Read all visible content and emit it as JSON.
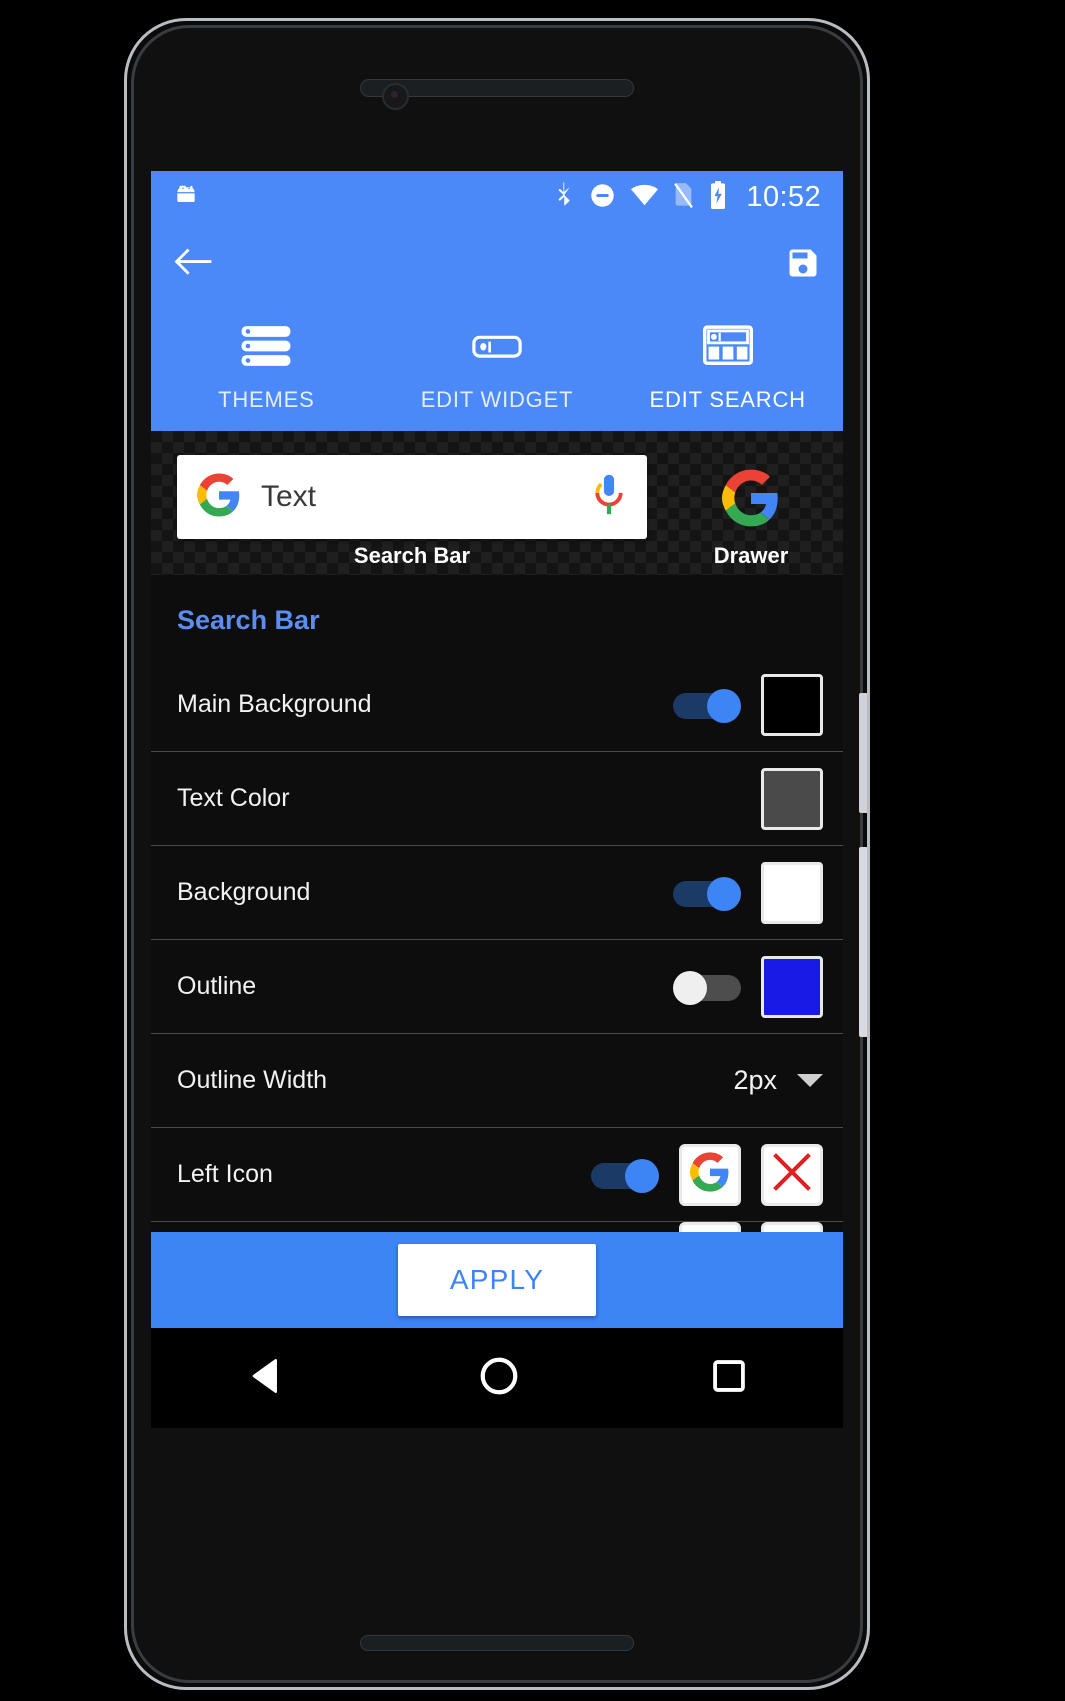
{
  "statusbar": {
    "time": "10:52",
    "icons": [
      "android-head-icon",
      "bluetooth-icon",
      "do-not-disturb-icon",
      "wifi-icon",
      "no-sim-icon",
      "battery-charging-icon"
    ]
  },
  "appbar": {
    "back_icon": "back-arrow-icon",
    "save_icon": "save-floppy-icon",
    "tabs": [
      {
        "label": "THEMES",
        "icon": "list-rows-icon",
        "active": false
      },
      {
        "label": "EDIT WIDGET",
        "icon": "widget-bar-icon",
        "active": false
      },
      {
        "label": "EDIT SEARCH",
        "icon": "search-layout-icon",
        "active": true
      }
    ]
  },
  "preview": {
    "search_text": "Text",
    "left_icon": "google-g-icon",
    "right_icon": "google-mic-icon",
    "searchbar_label": "Search Bar",
    "drawer_icon": "google-g-icon",
    "drawer_label": "Drawer"
  },
  "settings": {
    "section_title": "Search Bar",
    "rows": [
      {
        "label": "Main Background",
        "toggle": "on",
        "swatch_color": "#000000",
        "controls": [
          "toggle",
          "swatch"
        ]
      },
      {
        "label": "Text Color",
        "toggle": null,
        "swatch_color": "#4a4a4a",
        "controls": [
          "swatch"
        ]
      },
      {
        "label": "Background",
        "toggle": "on",
        "swatch_color": "#ffffff",
        "controls": [
          "toggle",
          "swatch"
        ]
      },
      {
        "label": "Outline",
        "toggle": "off",
        "swatch_color": "#1a1ae6",
        "controls": [
          "toggle",
          "swatch"
        ]
      },
      {
        "label": "Outline Width",
        "value": "2px",
        "controls": [
          "value",
          "caret"
        ]
      },
      {
        "label": "Left Icon",
        "toggle": "on",
        "icon_buttons": [
          "google-g-icon",
          "red-x-icon"
        ],
        "controls": [
          "toggle",
          "iconbutton",
          "iconbutton"
        ]
      }
    ]
  },
  "footer": {
    "apply_label": "APPLY"
  },
  "navbar": {
    "back": "nav-back-triangle-icon",
    "home": "nav-home-circle-icon",
    "recents": "nav-recents-square-icon"
  },
  "colors": {
    "accent_blue": "#4a89f7",
    "apply_blue": "#3d84f5",
    "section_blue": "#5c8df0",
    "surface": "#0d0d0d"
  }
}
